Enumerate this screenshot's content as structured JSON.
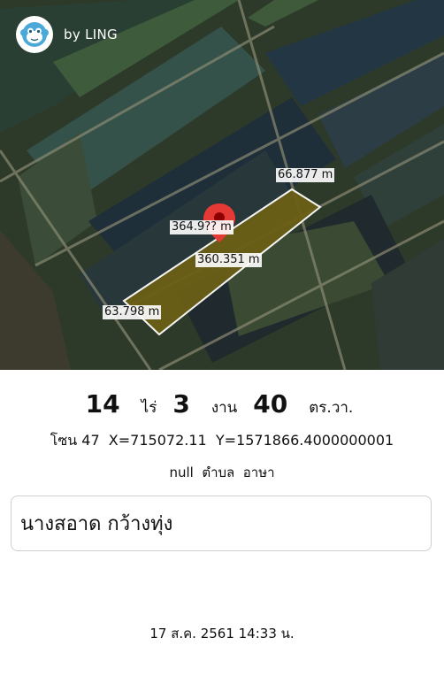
{
  "brand": {
    "text": "by LING",
    "logo_icon": "monkey-face-icon"
  },
  "map": {
    "pin_icon": "map-pin-icon",
    "plot_color": "#6b5f16",
    "measurements": {
      "top_right": "66.877 m",
      "top_long": "364.9?? m",
      "bottom_long": "360.351 m",
      "bottom_left": "63.798 m"
    }
  },
  "area": {
    "rai_value": "14",
    "rai_unit": "ไร่",
    "ngan_value": "3",
    "ngan_unit": "งาน",
    "wa_value": "40",
    "wa_unit": "ตร.วา."
  },
  "coordinates": "โซน 47  X=715072.11  Y=1571866.4000000001",
  "location": "null  ตำบล  อาษา",
  "owner_name": "นางสอาด กว้างทุ่ง",
  "date": "17 ส.ค. 2561 14:33 น."
}
